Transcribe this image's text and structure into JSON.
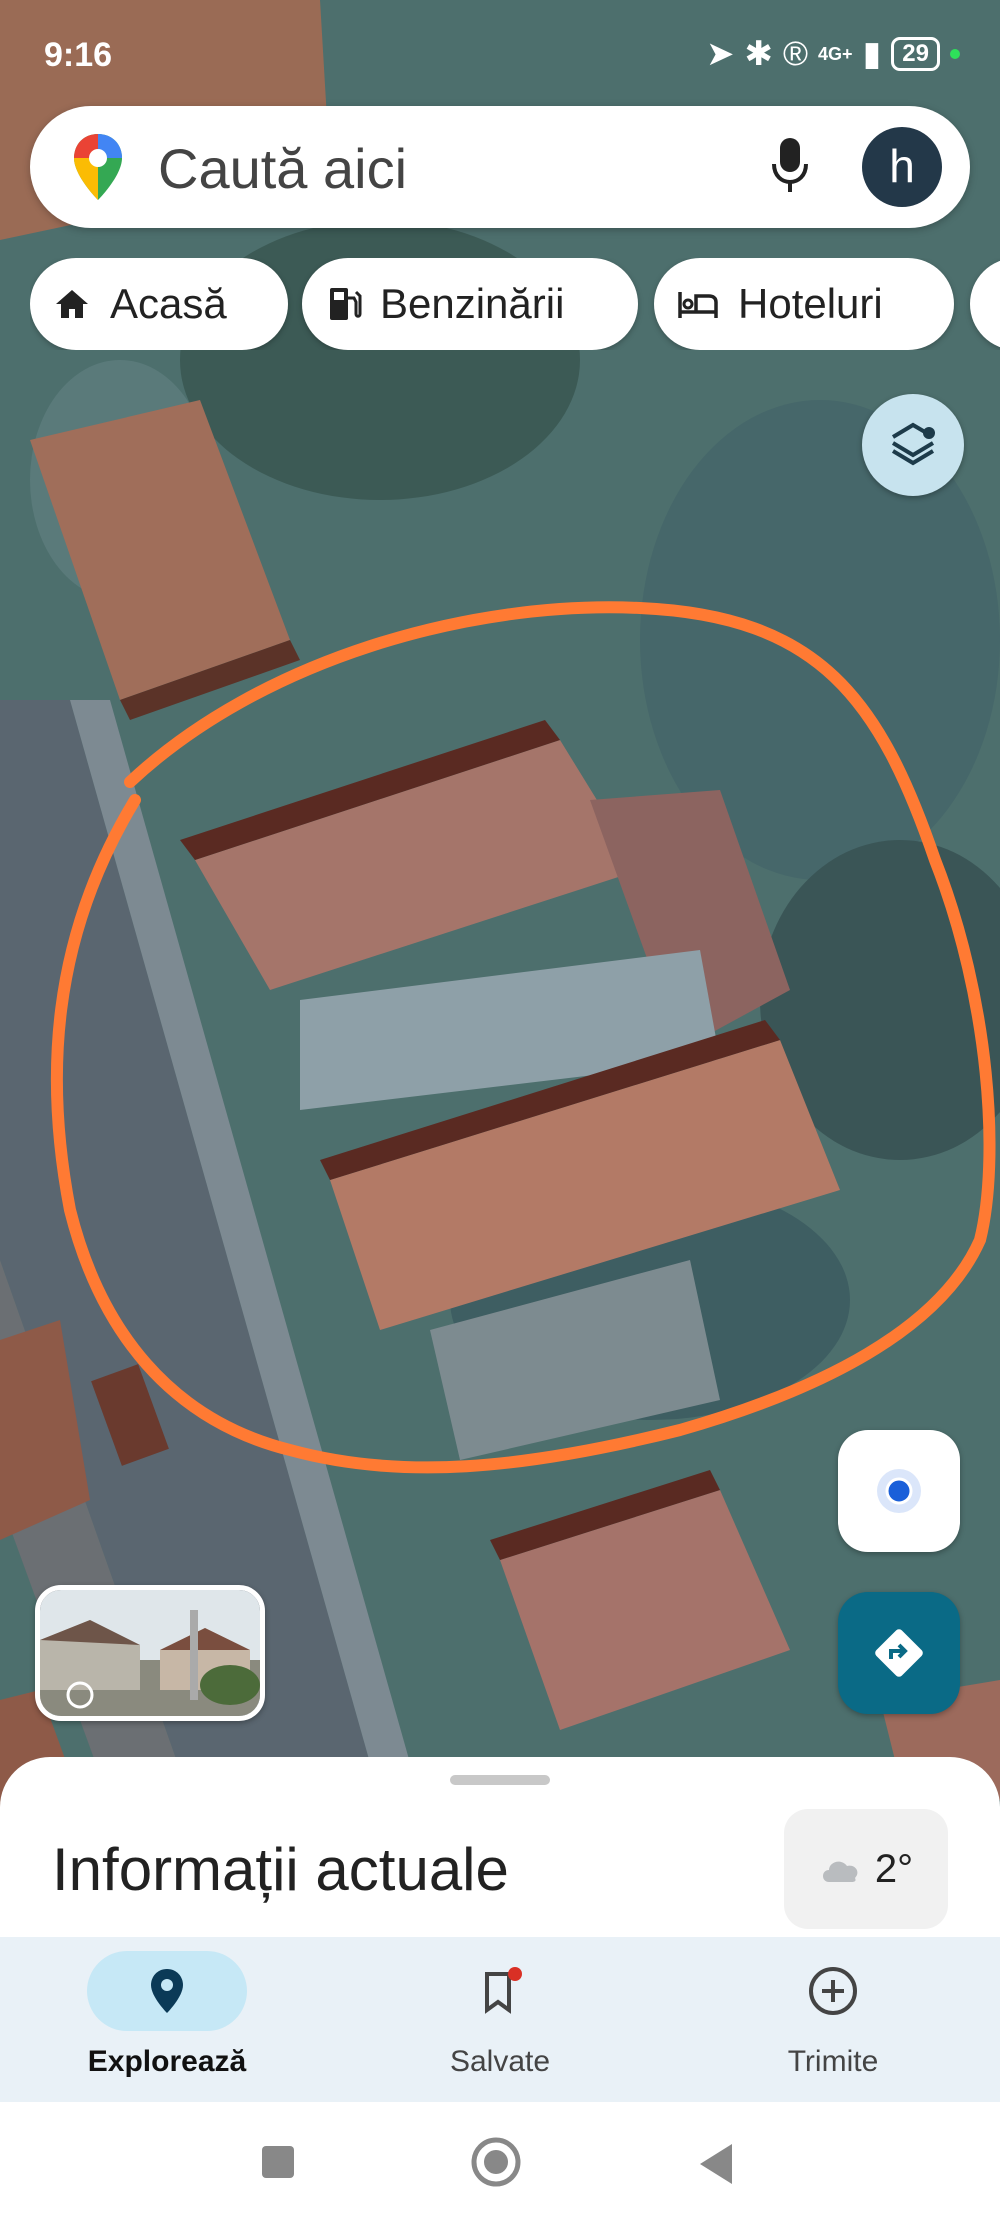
{
  "status_bar": {
    "time": "9:16",
    "network": "4G+",
    "battery": "29"
  },
  "search": {
    "placeholder": "Caută aici",
    "avatar_letter": "h"
  },
  "chips": [
    {
      "label": "Acasă",
      "icon": "home-icon"
    },
    {
      "label": "Benzinării",
      "icon": "gas-station-icon"
    },
    {
      "label": "Hoteluri",
      "icon": "hotel-icon"
    }
  ],
  "sheet": {
    "title": "Informații actuale",
    "weather": "2°"
  },
  "bottom_nav": {
    "items": [
      {
        "label": "Explorează",
        "icon": "explore-pin-icon",
        "active": true
      },
      {
        "label": "Salvate",
        "icon": "bookmark-icon",
        "active": false
      },
      {
        "label": "Trimite",
        "icon": "add-circle-icon",
        "active": false
      }
    ]
  },
  "colors": {
    "accent": "#0a6a86",
    "annotation": "#ff7a33",
    "active_tab": "#c6e8f6",
    "location_dot": "#1a5fd9"
  }
}
